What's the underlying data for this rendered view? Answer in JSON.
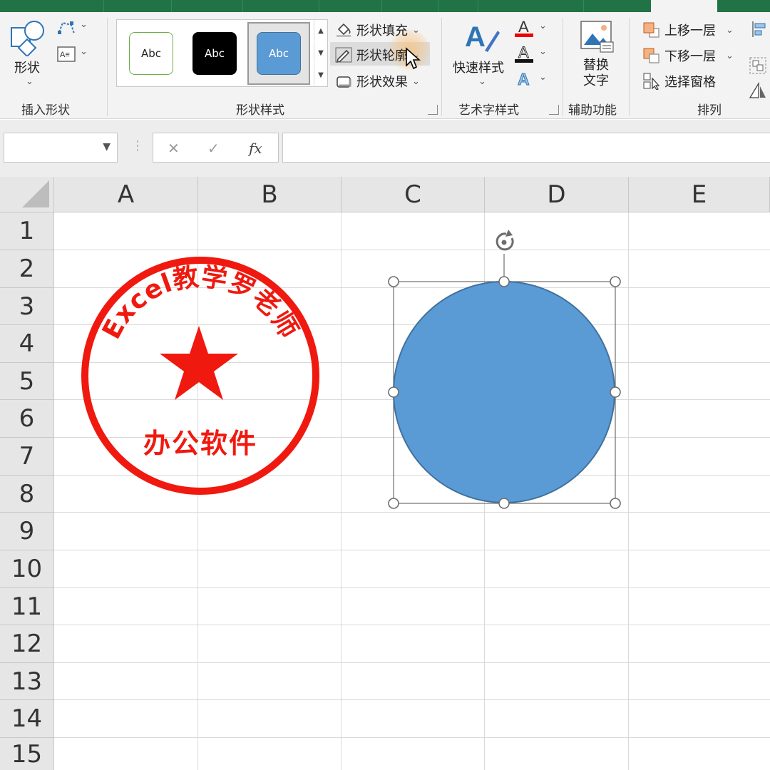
{
  "ribbon": {
    "insert_shape": {
      "shapes_label": "形状",
      "group_label": "插入形状"
    },
    "shape_styles": {
      "swatches": [
        "Abc",
        "Abc",
        "Abc"
      ],
      "fill_label": "形状填充",
      "outline_label": "形状轮廓",
      "effects_label": "形状效果",
      "group_label": "形状样式"
    },
    "wordart": {
      "quick_styles_label": "快速样式",
      "group_label": "艺术字样式"
    },
    "accessibility": {
      "alt_text_label_line1": "替换",
      "alt_text_label_line2": "文字",
      "group_label": "辅助功能"
    },
    "arrange": {
      "bring_forward_label": "上移一层",
      "send_backward_label": "下移一层",
      "selection_pane_label": "选择窗格",
      "group_label": "排列"
    }
  },
  "formula_bar": {
    "name_box_value": "",
    "cancel_symbol": "✕",
    "enter_symbol": "✓",
    "fx_symbol": "fx",
    "formula_value": ""
  },
  "sheet": {
    "columns": [
      "A",
      "B",
      "C",
      "D",
      "E"
    ],
    "rows": [
      "1",
      "2",
      "3",
      "4",
      "5",
      "6",
      "7",
      "8",
      "9",
      "10",
      "11",
      "12",
      "13",
      "14",
      "15"
    ]
  },
  "stamp": {
    "arc_text": "Excel教学罗老师",
    "bottom_text": "办公软件",
    "color": "#f0190f"
  },
  "selected_shape": {
    "type": "oval",
    "fill_color": "#5b9bd5",
    "outline_color": "#41719c"
  },
  "colors": {
    "accent_green": "#217346",
    "ribbon_bg": "#f3f3f3"
  }
}
